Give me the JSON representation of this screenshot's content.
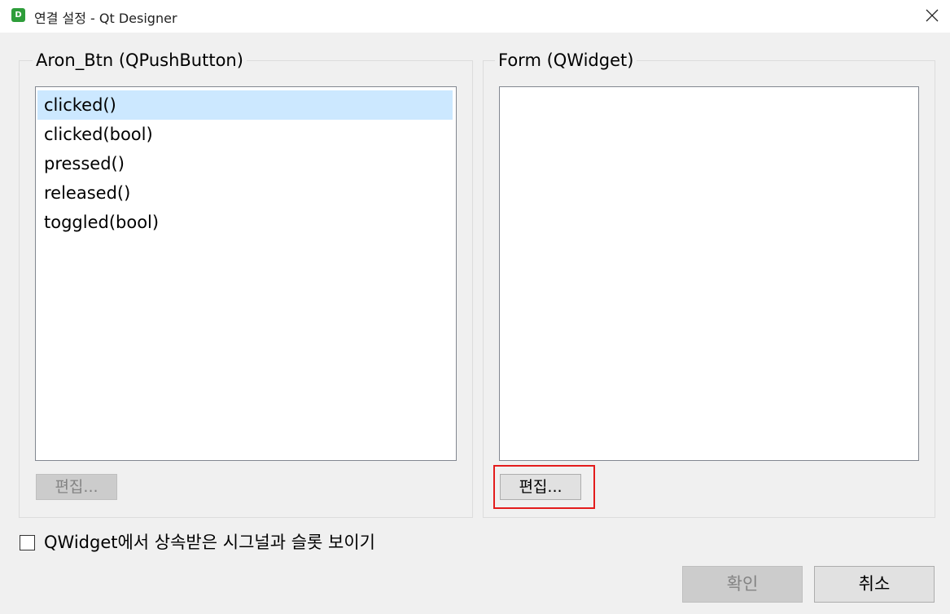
{
  "window": {
    "icon_letter": "D",
    "title": "연결 설정 - Qt Designer",
    "close_glyph": "✕"
  },
  "sender_group": {
    "title": "Aron_Btn (QPushButton)",
    "signals": [
      "clicked()",
      "clicked(bool)",
      "pressed()",
      "released()",
      "toggled(bool)"
    ],
    "selected_index": 0,
    "edit_label": "편집..."
  },
  "receiver_group": {
    "title": "Form (QWidget)",
    "slots": [],
    "edit_label": "편집..."
  },
  "inherited_checkbox": {
    "label": "QWidget에서 상속받은 시그널과 슬롯 보이기",
    "checked": false
  },
  "buttons": {
    "ok_label": "확인",
    "cancel_label": "취소"
  },
  "colors": {
    "selection": "#cce8ff",
    "highlight_box": "#e31c1c",
    "app_icon": "#2e9d3a"
  }
}
